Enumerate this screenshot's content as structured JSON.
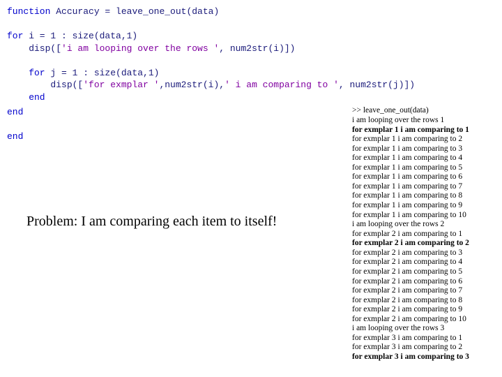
{
  "code": {
    "l1_a": "function",
    "l1_b": " Accuracy = leave_one_out(data)",
    "l2": "",
    "l3_a": "for",
    "l3_b": " i = 1 : size(data,1)",
    "l4_a": "    disp([",
    "l4_b": "'i am looping over the rows '",
    "l4_c": ", num2str(i)])",
    "l5": "",
    "l6_a": "    for",
    "l6_b": " j = 1 : size(data,1)",
    "l7_a": "        disp([",
    "l7_b": "'for exmplar '",
    "l7_c": ",num2str(i),",
    "l7_d": "' i am comparing to '",
    "l7_e": ", num2str(j)])",
    "l8": "    end",
    "l9": "",
    "l10": "end",
    "l11": "",
    "l12": "end"
  },
  "problem": "Problem: I am comparing each item to itself!",
  "output": {
    "cmd": ">> leave_one_out(data)",
    "loop1": "i am looping over the rows 1",
    "e1_1": "for exmplar 1 i am comparing to 1",
    "e1_2": "for exmplar 1 i am comparing to 2",
    "e1_3": "for exmplar 1 i am comparing to 3",
    "e1_4": "for exmplar 1 i am comparing to 4",
    "e1_5": "for exmplar 1 i am comparing to 5",
    "e1_6": "for exmplar 1 i am comparing to 6",
    "e1_7": "for exmplar 1 i am comparing to 7",
    "e1_8": "for exmplar 1 i am comparing to 8",
    "e1_9": "for exmplar 1 i am comparing to 9",
    "e1_10": "for exmplar 1 i am comparing to 10",
    "loop2": "i am looping over the rows 2",
    "e2_1": "for exmplar 2 i am comparing to 1",
    "e2_2": "for exmplar 2 i am comparing to 2",
    "e2_3": "for exmplar 2 i am comparing to 3",
    "e2_4": "for exmplar 2 i am comparing to 4",
    "e2_5": "for exmplar 2 i am comparing to 5",
    "e2_6": "for exmplar 2 i am comparing to 6",
    "e2_7": "for exmplar 2 i am comparing to 7",
    "e2_8": "for exmplar 2 i am comparing to 8",
    "e2_9": "for exmplar 2 i am comparing to 9",
    "e2_10": "for exmplar 2 i am comparing to 10",
    "loop3": "i am looping over the rows 3",
    "e3_1": "for exmplar 3 i am comparing to 1",
    "e3_2": "for exmplar 3 i am comparing to 2",
    "e3_3": "for exmplar 3 i am comparing to 3"
  }
}
